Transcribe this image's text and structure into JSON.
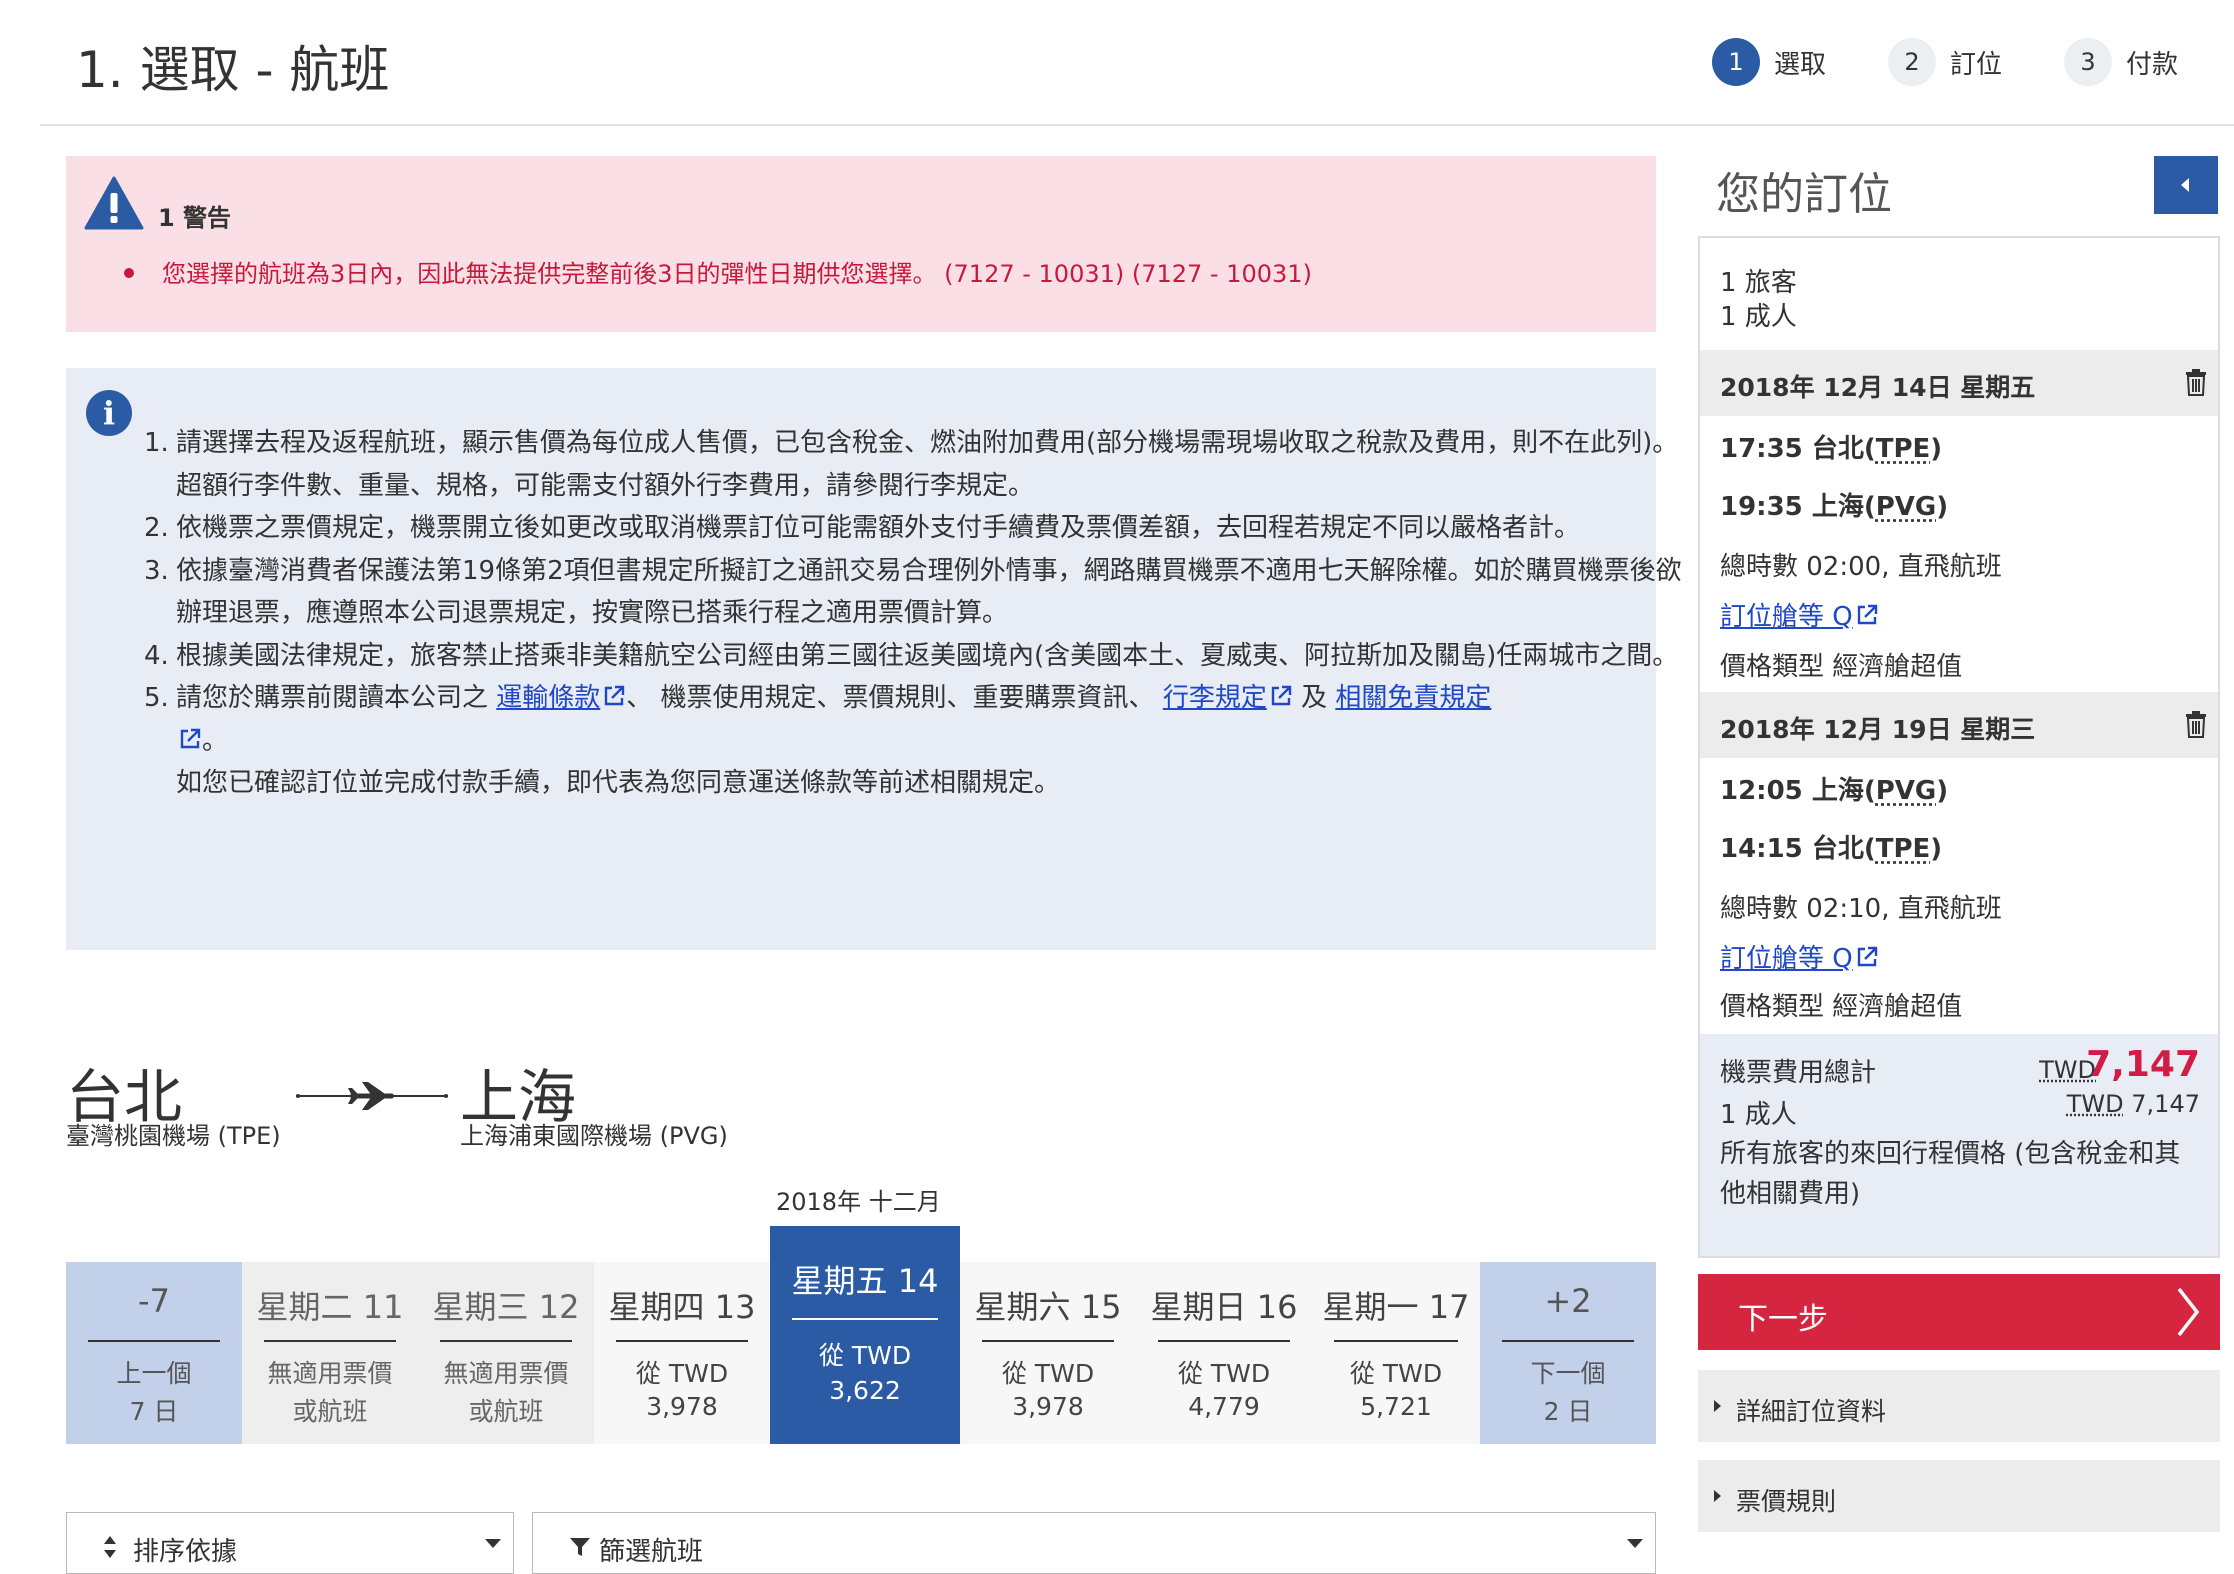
{
  "header": {
    "title": "1. 選取 - 航班",
    "steps": [
      {
        "num": "1",
        "label": "選取"
      },
      {
        "num": "2",
        "label": "訂位"
      },
      {
        "num": "3",
        "label": "付款"
      }
    ]
  },
  "warning": {
    "title": "1 警告",
    "message": "您選擇的航班為3日內，因此無法提供完整前後3日的彈性日期供您選擇。 (7127 - 10031) (7127 - 10031)"
  },
  "info": {
    "items": [
      {
        "num": "1.",
        "text": "請選擇去程及返程航班，顯示售價為每位成人售價，已包含稅金、燃油附加費用(部分機場需現場收取之稅款及費用，則不在此列)。超額行李件數、重量、規格，可能需支付額外行李費用，請參閱行李規定。"
      },
      {
        "num": "2.",
        "text": "依機票之票價規定，機票開立後如更改或取消機票訂位可能需額外支付手續費及票價差額，去回程若規定不同以嚴格者計。"
      },
      {
        "num": "3.",
        "text": "依據臺灣消費者保護法第19條第2項但書規定所擬訂之通訊交易合理例外情事，網路購買機票不適用七天解除權。如於購買機票後欲辦理退票，應遵照本公司退票規定，按實際已搭乘行程之適用票價計算。"
      },
      {
        "num": "4.",
        "text": "根據美國法律規定，旅客禁止搭乘非美籍航空公司經由第三國往返美國境內(含美國本土、夏威夷、阿拉斯加及關島)任兩城市之間。"
      }
    ],
    "item5": {
      "num": "5.",
      "prefix": "請您於購票前閱讀本公司之 ",
      "link1": "運輸條款",
      "mid1": "、 機票使用規定、票價規則、重要購票資訊、 ",
      "link2": "行李規定",
      "mid2": " 及 ",
      "link3": "相關免責規定",
      "end": "。",
      "confirm": "如您已確認訂位並完成付款手續，即代表為您同意運送條款等前述相關規定。"
    }
  },
  "route": {
    "from_city": "台北",
    "from_airport": "臺灣桃園機場 (TPE)",
    "to_city": "上海",
    "to_airport": "上海浦東國際機場 (PVG)"
  },
  "dates": {
    "month_label": "2018年 十二月",
    "cells": [
      {
        "kind": "nav",
        "name": "-7",
        "l1": "上一個",
        "l2": "7 日"
      },
      {
        "kind": "na",
        "name": "星期二 11",
        "l1": "無適用票價",
        "l2": "或航班"
      },
      {
        "kind": "na",
        "name": "星期三 12",
        "l1": "無適用票價",
        "l2": "或航班"
      },
      {
        "kind": "avail",
        "name": "星期四 13",
        "l1": "從 TWD",
        "l2": "3,978"
      },
      {
        "kind": "sel",
        "name": "星期五 14",
        "l1": "從 TWD",
        "l2": "3,622"
      },
      {
        "kind": "avail",
        "name": "星期六 15",
        "l1": "從 TWD",
        "l2": "3,978"
      },
      {
        "kind": "avail",
        "name": "星期日 16",
        "l1": "從 TWD",
        "l2": "4,779"
      },
      {
        "kind": "avail",
        "name": "星期一 17",
        "l1": "從 TWD",
        "l2": "5,721"
      },
      {
        "kind": "nav",
        "name": "+2",
        "l1": "下一個",
        "l2": "2 日"
      }
    ]
  },
  "controls": {
    "sort_label": "排序依據",
    "filter_label": "篩選航班"
  },
  "sidebar": {
    "title": "您的訂位",
    "travelers": "1 旅客",
    "adults": "1 成人",
    "outbound": {
      "date": "2018年 12月 14日 星期五",
      "dep_time": "17:35 台北(",
      "dep_code": "TPE",
      "arr_time": "19:35 上海(",
      "arr_code": "PVG",
      "duration": "總時數 02:00, 直飛航班",
      "cabin_link": "訂位艙等 Q",
      "fare_type": "價格類型 經濟艙超值"
    },
    "inbound": {
      "date": "2018年 12月 19日 星期三",
      "dep_time": "12:05 上海(",
      "dep_code": "PVG",
      "arr_time": "14:15 台北(",
      "arr_code": "TPE",
      "duration": "總時數 02:10, 直飛航班",
      "cabin_link": "訂位艙等 Q",
      "fare_type": "價格類型 經濟艙超值"
    },
    "total_label": "機票費用總計",
    "total_currency": "TWD",
    "total_amount": "7,147",
    "adult_label": "1 成人",
    "adult_currency": "TWD",
    "adult_amount": "7,147",
    "note": "所有旅客的來回行程價格 (包含稅金和其他相關費用)",
    "next_label": "下一步",
    "accordion": [
      "詳細訂位資料",
      "票價規則"
    ]
  },
  "colors": {
    "brand_blue": "#2a5ba4",
    "alert_red": "#c8193c",
    "price_red": "#d01d45",
    "next_button": "#d6253f"
  }
}
